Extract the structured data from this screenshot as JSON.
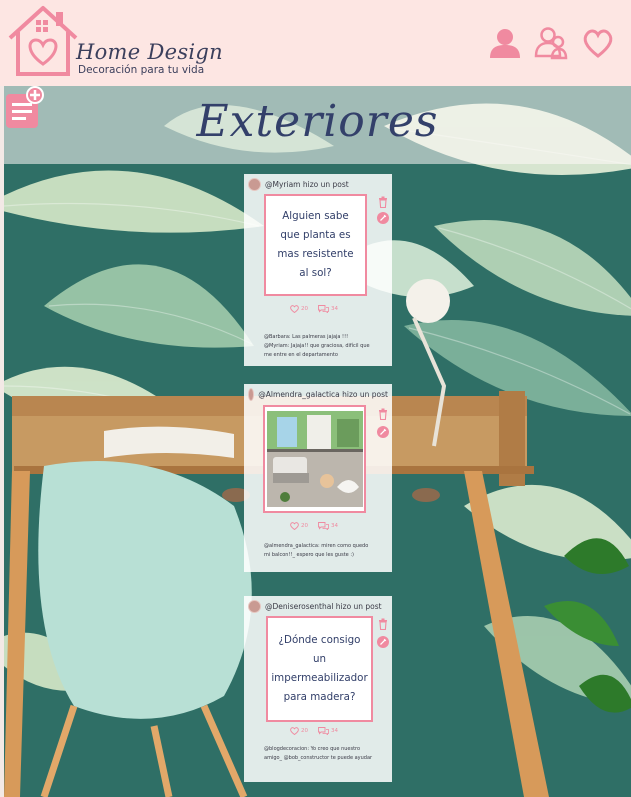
{
  "header": {
    "brand_name": "Home Design",
    "tagline": "Decoración para tu vida",
    "icons": [
      "user-icon",
      "users-icon",
      "heart-icon"
    ],
    "accent_color": "#f08aa0"
  },
  "page": {
    "title": "Exteriores",
    "new_post_icon": "add-note-icon"
  },
  "posts": [
    {
      "author": "@Myriam hizo un post",
      "text": "Alguien sabe que planta es mas resistente al sol?",
      "likes": "20",
      "comments_count": "34",
      "comments": [
        "@Barbara: Las palmeras jajaja !!!",
        "@Myriam: Jajaja!! que graciosa, difícil que me entre en el departamento"
      ]
    },
    {
      "author": "@Almendra_galactica hizo un post",
      "image": "balcony-photo",
      "likes": "20",
      "comments_count": "34",
      "comments": [
        "@almendra_galactica: miren como quedo mi balcon!!_ espero que les guste :)"
      ]
    },
    {
      "author": "@Deniserosenthal hizo un post",
      "text": "¿Dónde consigo un impermeabilizador para madera?",
      "likes": "20",
      "comments_count": "34",
      "comments": [
        "@blogdecoracion: Yo creo que nuestro amigo_ @bob_constructor te puede ayudar"
      ]
    }
  ]
}
